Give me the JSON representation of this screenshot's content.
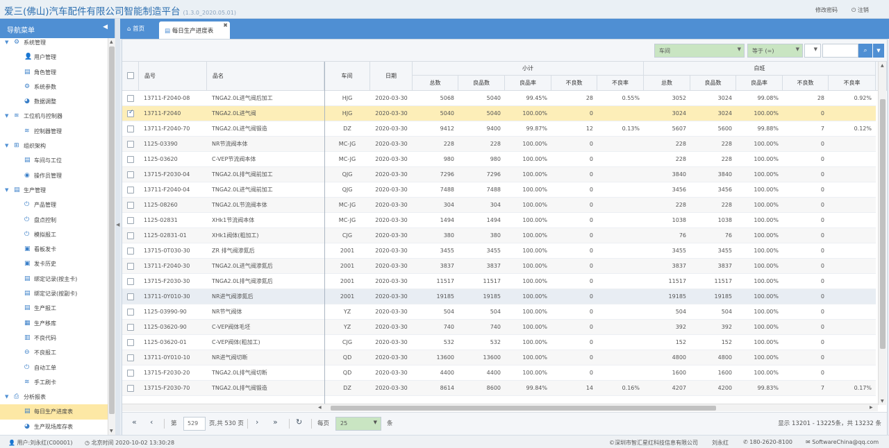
{
  "app": {
    "title": "爱三(佛山)汽车配件有限公司智能制造平台",
    "version": "(1.3.0_2020.05.01)",
    "change_password": "修改密码",
    "logout": "注销"
  },
  "sidebar": {
    "title": "导航菜单",
    "items": [
      {
        "type": "group",
        "label": "系统管理",
        "icon": "gear-icon"
      },
      {
        "type": "leaf",
        "label": "用户管理",
        "icon": "user-icon"
      },
      {
        "type": "leaf",
        "label": "角色管理",
        "icon": "list-icon"
      },
      {
        "type": "leaf",
        "label": "系统参数",
        "icon": "gears-icon"
      },
      {
        "type": "leaf",
        "label": "数据调整",
        "icon": "pie-icon"
      },
      {
        "type": "group",
        "label": "工位机与控制器",
        "icon": "wifi-icon"
      },
      {
        "type": "leaf",
        "label": "控制器管理",
        "icon": "wifi-icon"
      },
      {
        "type": "group",
        "label": "组织架构",
        "icon": "sitemap-icon"
      },
      {
        "type": "leaf",
        "label": "车间与工位",
        "icon": "list-icon"
      },
      {
        "type": "leaf",
        "label": "操作员管理",
        "icon": "user-circle-icon"
      },
      {
        "type": "group",
        "label": "生产管理",
        "icon": "list-icon"
      },
      {
        "type": "leaf",
        "label": "产品管理",
        "icon": "power-icon"
      },
      {
        "type": "leaf",
        "label": "盘点控制",
        "icon": "power-icon"
      },
      {
        "type": "leaf",
        "label": "模拟报工",
        "icon": "power-icon"
      },
      {
        "type": "leaf",
        "label": "看板发卡",
        "icon": "card-icon"
      },
      {
        "type": "leaf",
        "label": "发卡历史",
        "icon": "card-icon"
      },
      {
        "type": "leaf",
        "label": "绑定记录(按主卡)",
        "icon": "list-icon"
      },
      {
        "type": "leaf",
        "label": "绑定记录(按副卡)",
        "icon": "list-icon"
      },
      {
        "type": "leaf",
        "label": "生产报工",
        "icon": "list-icon"
      },
      {
        "type": "leaf",
        "label": "生产移库",
        "icon": "truck-icon"
      },
      {
        "type": "leaf",
        "label": "不良代码",
        "icon": "barcode-icon"
      },
      {
        "type": "leaf",
        "label": "不良报工",
        "icon": "search-minus-icon"
      },
      {
        "type": "leaf",
        "label": "自动工单",
        "icon": "power-icon"
      },
      {
        "type": "leaf",
        "label": "手工刷卡",
        "icon": "wifi-icon"
      },
      {
        "type": "group",
        "label": "分析报表",
        "icon": "print-icon"
      },
      {
        "type": "leaf",
        "label": "每日生产进度表",
        "icon": "list-icon",
        "active": true
      },
      {
        "type": "leaf",
        "label": "生产现场库存表",
        "icon": "pie-icon"
      }
    ]
  },
  "tabs": {
    "home": "首页",
    "active": "每日生产进度表"
  },
  "filter": {
    "field": "车间",
    "operator": "等于 (=)",
    "value": ""
  },
  "grid": {
    "headers": {
      "product_no": "品号",
      "product_name": "品名",
      "workshop": "车间",
      "date": "日期",
      "group1": "小计",
      "group2": "白班",
      "total": "总数",
      "good": "良品数",
      "good_rate": "良品率",
      "bad": "不良数",
      "bad_rate": "不良率"
    },
    "rows": [
      [
        "13711-F2040-08",
        "TNGA2.0L进气阀后加工",
        "HJG",
        "2020-03-30",
        "5068",
        "5040",
        "99.45%",
        "28",
        "0.55%",
        "3052",
        "3024",
        "99.08%",
        "28",
        "0.92%"
      ],
      [
        "13711-F2040",
        "TNGA2.0L进气阀",
        "HJG",
        "2020-03-30",
        "5040",
        "5040",
        "100.00%",
        "0",
        "",
        "3024",
        "3024",
        "100.00%",
        "0",
        ""
      ],
      [
        "13711-F2040-70",
        "TNGA2.0L进气阀锻造",
        "DZ",
        "2020-03-30",
        "9412",
        "9400",
        "99.87%",
        "12",
        "0.13%",
        "5607",
        "5600",
        "99.88%",
        "7",
        "0.12%"
      ],
      [
        "1125-03390",
        "NR节流阀本体",
        "MC-JG",
        "2020-03-30",
        "228",
        "228",
        "100.00%",
        "0",
        "",
        "228",
        "228",
        "100.00%",
        "0",
        ""
      ],
      [
        "1125-03620",
        "C-VEP节流阀本体",
        "MC-JG",
        "2020-03-30",
        "980",
        "980",
        "100.00%",
        "0",
        "",
        "228",
        "228",
        "100.00%",
        "0",
        ""
      ],
      [
        "13715-F2030-04",
        "TNGA2.0L排气阀前加工",
        "QJG",
        "2020-03-30",
        "7296",
        "7296",
        "100.00%",
        "0",
        "",
        "3840",
        "3840",
        "100.00%",
        "0",
        ""
      ],
      [
        "13711-F2040-04",
        "TNGA2.0L进气阀前加工",
        "QJG",
        "2020-03-30",
        "7488",
        "7488",
        "100.00%",
        "0",
        "",
        "3456",
        "3456",
        "100.00%",
        "0",
        ""
      ],
      [
        "1125-08260",
        "TNGA2.0L节流阀本体",
        "MC-JG",
        "2020-03-30",
        "304",
        "304",
        "100.00%",
        "0",
        "",
        "228",
        "228",
        "100.00%",
        "0",
        ""
      ],
      [
        "1125-02831",
        "XHk1节流阀本体",
        "MC-JG",
        "2020-03-30",
        "1494",
        "1494",
        "100.00%",
        "0",
        "",
        "1038",
        "1038",
        "100.00%",
        "0",
        ""
      ],
      [
        "1125-02831-01",
        "XHk1阀体(粗加工)",
        "CJG",
        "2020-03-30",
        "380",
        "380",
        "100.00%",
        "0",
        "",
        "76",
        "76",
        "100.00%",
        "0",
        ""
      ],
      [
        "13715-0T030-30",
        "ZR 排气阀渗氮后",
        "2001",
        "2020-03-30",
        "3455",
        "3455",
        "100.00%",
        "0",
        "",
        "3455",
        "3455",
        "100.00%",
        "0",
        ""
      ],
      [
        "13711-F2040-30",
        "TNGA2.0L进气阀渗氮后",
        "2001",
        "2020-03-30",
        "3837",
        "3837",
        "100.00%",
        "0",
        "",
        "3837",
        "3837",
        "100.00%",
        "0",
        ""
      ],
      [
        "13715-F2030-30",
        "TNGA2.0L排气阀渗氮后",
        "2001",
        "2020-03-30",
        "11517",
        "11517",
        "100.00%",
        "0",
        "",
        "11517",
        "11517",
        "100.00%",
        "0",
        ""
      ],
      [
        "13711-0Y010-30",
        "NR进气阀渗氮后",
        "2001",
        "2020-03-30",
        "19185",
        "19185",
        "100.00%",
        "0",
        "",
        "19185",
        "19185",
        "100.00%",
        "0",
        ""
      ],
      [
        "1125-03990-90",
        "NR节气阀体",
        "YZ",
        "2020-03-30",
        "504",
        "504",
        "100.00%",
        "0",
        "",
        "504",
        "504",
        "100.00%",
        "0",
        ""
      ],
      [
        "1125-03620-90",
        "C-VEP阀体毛坯",
        "YZ",
        "2020-03-30",
        "740",
        "740",
        "100.00%",
        "0",
        "",
        "392",
        "392",
        "100.00%",
        "0",
        ""
      ],
      [
        "1125-03620-01",
        "C-VEP阀体(粗加工)",
        "CJG",
        "2020-03-30",
        "532",
        "532",
        "100.00%",
        "0",
        "",
        "152",
        "152",
        "100.00%",
        "0",
        ""
      ],
      [
        "13711-0Y010-10",
        "NR进气阀切断",
        "QD",
        "2020-03-30",
        "13600",
        "13600",
        "100.00%",
        "0",
        "",
        "4800",
        "4800",
        "100.00%",
        "0",
        ""
      ],
      [
        "13715-F2030-20",
        "TNGA2.0L排气阀切断",
        "QD",
        "2020-03-30",
        "4400",
        "4400",
        "100.00%",
        "0",
        "",
        "1600",
        "1600",
        "100.00%",
        "0",
        ""
      ],
      [
        "13715-F2030-70",
        "TNGA2.0L排气阀锻造",
        "DZ",
        "2020-03-30",
        "8614",
        "8600",
        "99.84%",
        "14",
        "0.16%",
        "4207",
        "4200",
        "99.83%",
        "7",
        "0.17%"
      ]
    ],
    "selected_row": 1,
    "hover_row": 13
  },
  "pager": {
    "page_label": "第",
    "page": "529",
    "total_pages": "页,共 530 页",
    "per_page_label": "每页",
    "per_page": "25",
    "unit": "条",
    "summary": "显示 13201 - 13225条，共 13232 条"
  },
  "status": {
    "user": "用户:刘永红(C00001)",
    "time": "北京时间 2020-10-02 13:30:28",
    "copyright": "©深圳市智汇星红科技信息有限公司",
    "person": "刘永红",
    "phone": "180-2620-8100",
    "email": "SoftwareChina@qq.com"
  }
}
